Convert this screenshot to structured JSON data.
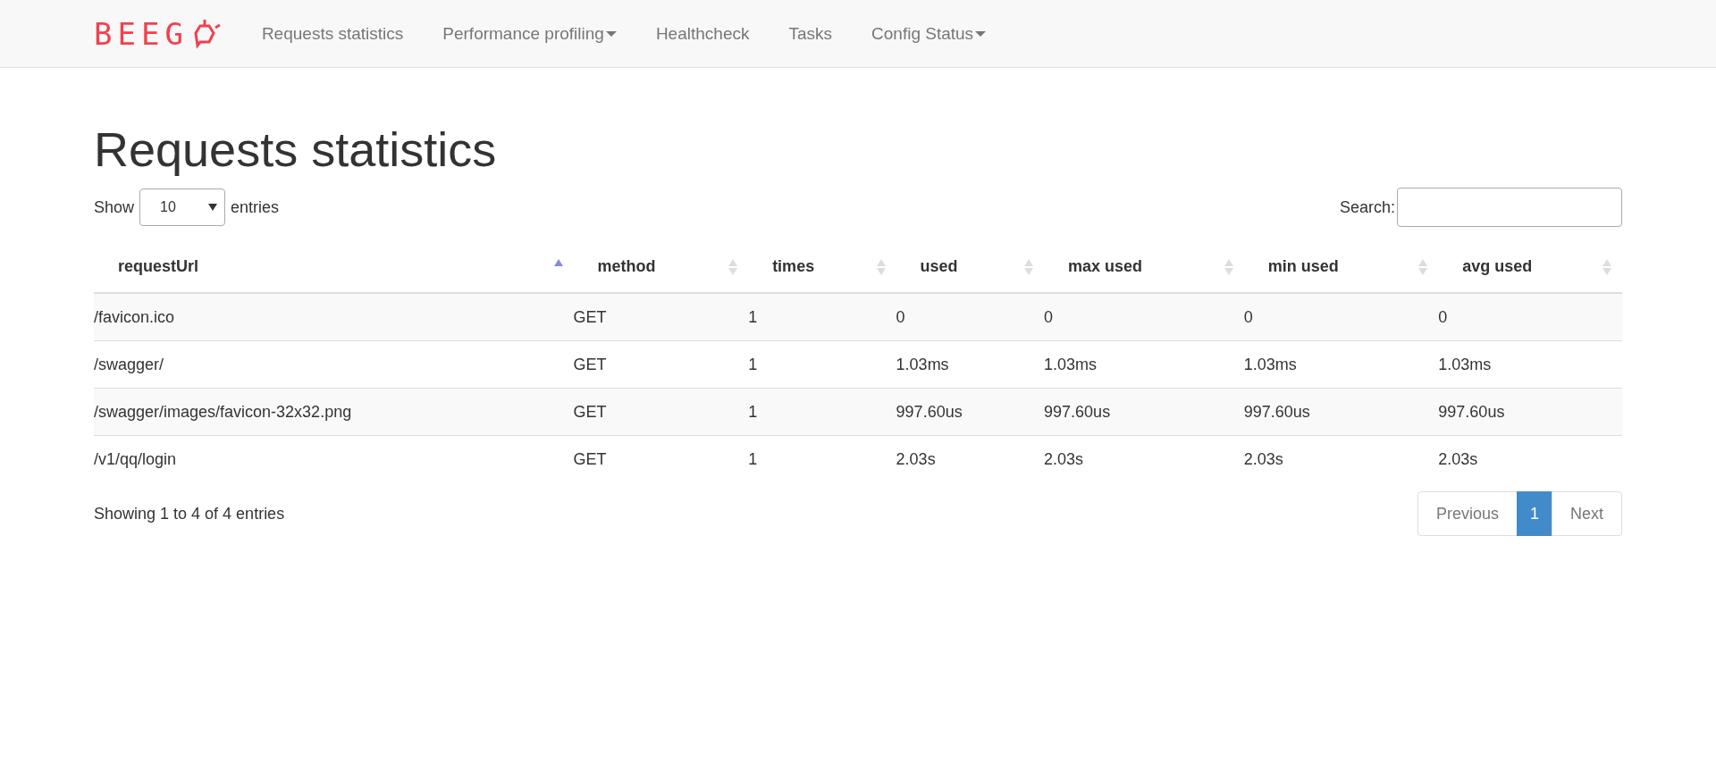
{
  "navbar": {
    "brand": "BEEG",
    "items": [
      {
        "label": "Requests statistics",
        "dropdown": false
      },
      {
        "label": "Performance profiling",
        "dropdown": true
      },
      {
        "label": "Healthcheck",
        "dropdown": false
      },
      {
        "label": "Tasks",
        "dropdown": false
      },
      {
        "label": "Config Status",
        "dropdown": true
      }
    ]
  },
  "title": "Requests statistics",
  "length_control": {
    "before": "Show",
    "value": "10",
    "after": "entries"
  },
  "search": {
    "label": "Search:"
  },
  "table": {
    "columns": [
      {
        "label": "requestUrl",
        "sorted": true
      },
      {
        "label": "method",
        "sorted": false
      },
      {
        "label": "times",
        "sorted": false
      },
      {
        "label": "used",
        "sorted": false
      },
      {
        "label": "max used",
        "sorted": false
      },
      {
        "label": "min used",
        "sorted": false
      },
      {
        "label": "avg used",
        "sorted": false
      }
    ],
    "rows": [
      [
        "/favicon.ico",
        "GET",
        "1",
        "0",
        "0",
        "0",
        "0"
      ],
      [
        "/swagger/",
        "GET",
        "1",
        "1.03ms",
        "1.03ms",
        "1.03ms",
        "1.03ms"
      ],
      [
        "/swagger/images/favicon-32x32.png",
        "GET",
        "1",
        "997.60us",
        "997.60us",
        "997.60us",
        "997.60us"
      ],
      [
        "/v1/qq/login",
        "GET",
        "1",
        "2.03s",
        "2.03s",
        "2.03s",
        "2.03s"
      ]
    ]
  },
  "info": "Showing 1 to 4 of 4 entries",
  "pagination": {
    "previous": "Previous",
    "pages": [
      {
        "label": "1",
        "selected": true
      }
    ],
    "next": "Next"
  }
}
